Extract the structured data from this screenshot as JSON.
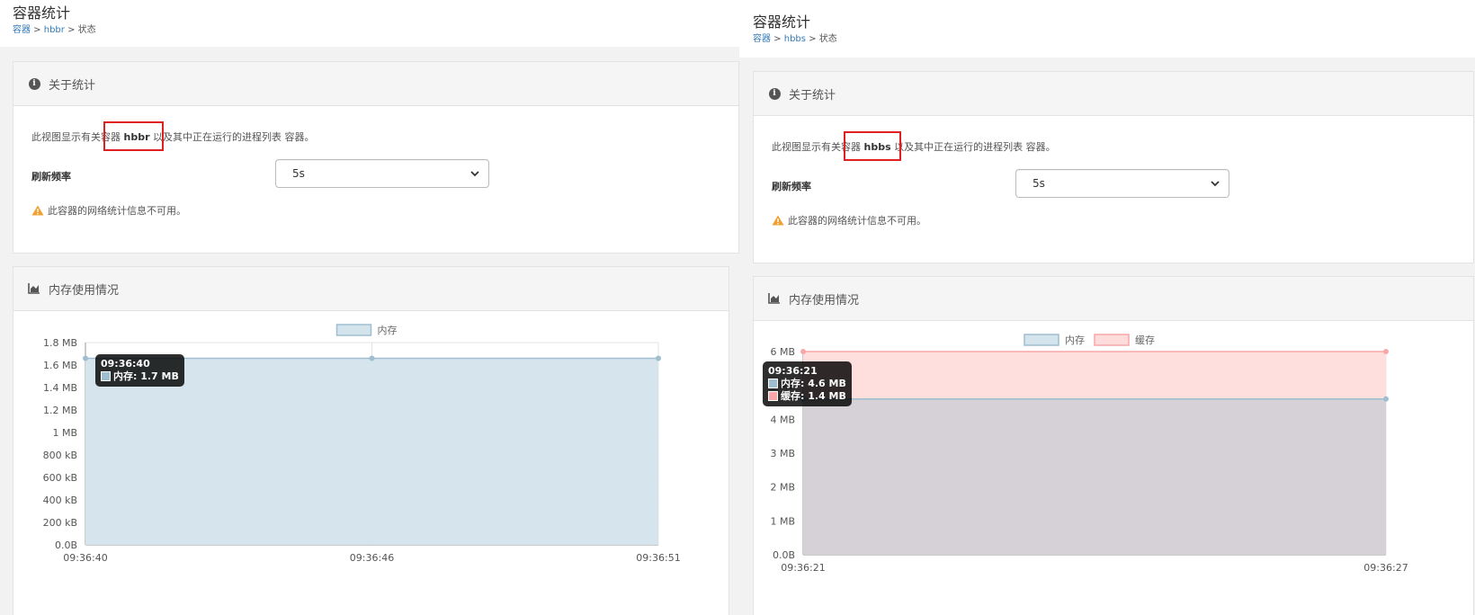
{
  "left": {
    "title": "容器统计",
    "breadcrumb": {
      "item1": "容器",
      "sep1": " > ",
      "item2": "hbbr",
      "sep2": " > ",
      "item3": "状态"
    },
    "about": {
      "heading": "关于统计",
      "desc_pre": "此视图显示有关",
      "desc_hl_text": "容器 ",
      "desc_hl_name": "hbbr",
      "desc_post": " 以及其中正在运行的进程列表 容器。",
      "refresh_label": "刷新频率",
      "refresh_value": "5s",
      "warning": "此容器的网络统计信息不可用。"
    },
    "memory": {
      "heading": "内存使用情况",
      "tooltip": {
        "time": "09:36:40",
        "line1": "内存: 1.7 MB"
      }
    }
  },
  "right": {
    "title": "容器统计",
    "breadcrumb": {
      "item1": "容器",
      "sep1": " > ",
      "item2": "hbbs",
      "sep2": " > ",
      "item3": "状态"
    },
    "about": {
      "heading": "关于统计",
      "desc_pre": "此视图显示有关",
      "desc_hl_text": "容器 ",
      "desc_hl_name": "hbbs",
      "desc_post": " 以及其中正在运行的进程列表 容器。",
      "refresh_label": "刷新频率",
      "refresh_value": "5s",
      "warning": "此容器的网络统计信息不可用。"
    },
    "memory": {
      "heading": "内存使用情况",
      "tooltip": {
        "time": "09:36:21",
        "line1": "内存: 4.6 MB",
        "line2": "缓存: 1.4 MB"
      }
    }
  },
  "colors": {
    "memory_fill": "#d4e4ec",
    "memory_line": "#9fbed0",
    "cache_fill": "#ffdcdc",
    "cache_line": "#f7a7a7",
    "overlap_fill": "#d3d0d6",
    "highlight_red": "#e02020",
    "link": "#337ab7",
    "warn": "#f0a030"
  },
  "chart_data": [
    {
      "type": "area",
      "title": "",
      "legend": [
        "内存"
      ],
      "legend_placement": "top-center",
      "y_tick_labels": [
        "0.0B",
        "200 kB",
        "400 kB",
        "600 kB",
        "800 kB",
        "1 MB",
        "1.2 MB",
        "1.4 MB",
        "1.6 MB",
        "1.8 MB"
      ],
      "ylim": [
        0,
        1.8
      ],
      "yunit": "MB",
      "x": [
        "09:36:40",
        "09:36:46",
        "09:36:51"
      ],
      "series": [
        {
          "name": "内存",
          "values": [
            1.66,
            1.66,
            1.66
          ]
        }
      ],
      "grid": true
    },
    {
      "type": "area",
      "title": "",
      "legend": [
        "内存",
        "缓存"
      ],
      "legend_placement": "top-center",
      "y_tick_labels": [
        "0.0B",
        "1 MB",
        "2 MB",
        "3 MB",
        "4 MB",
        "5 MB",
        "6 MB"
      ],
      "ylim": [
        0,
        6
      ],
      "yunit": "MB",
      "x": [
        "09:36:21",
        "09:36:27"
      ],
      "series": [
        {
          "name": "内存",
          "values": [
            4.6,
            4.6
          ]
        },
        {
          "name": "缓存",
          "values": [
            6.0,
            6.0
          ]
        }
      ],
      "grid": true
    }
  ]
}
